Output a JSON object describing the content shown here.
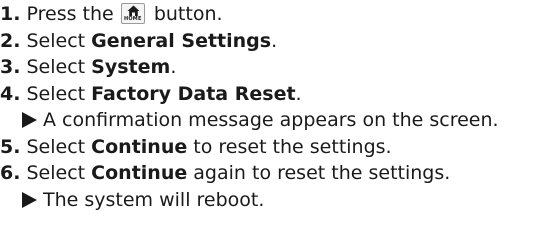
{
  "steps": [
    {
      "number": "1.",
      "pre": "Press the",
      "icon": "home-button-icon",
      "icon_label": "HOME",
      "post": "button."
    },
    {
      "number": "2.",
      "pre": "Select",
      "strong": "General Settings",
      "post": "."
    },
    {
      "number": "3.",
      "pre": "Select",
      "strong": "System",
      "post": "."
    },
    {
      "number": "4.",
      "pre": "Select",
      "strong": "Factory Data Reset",
      "post": "."
    },
    {
      "result": "A confirmation message appears on the screen."
    },
    {
      "number": "5.",
      "pre": "Select",
      "strong": "Continue",
      "post": "to reset the settings."
    },
    {
      "number": "6.",
      "pre": "Select",
      "strong": "Continue",
      "post": "again to reset the settings."
    },
    {
      "result": "The system will reboot."
    }
  ]
}
